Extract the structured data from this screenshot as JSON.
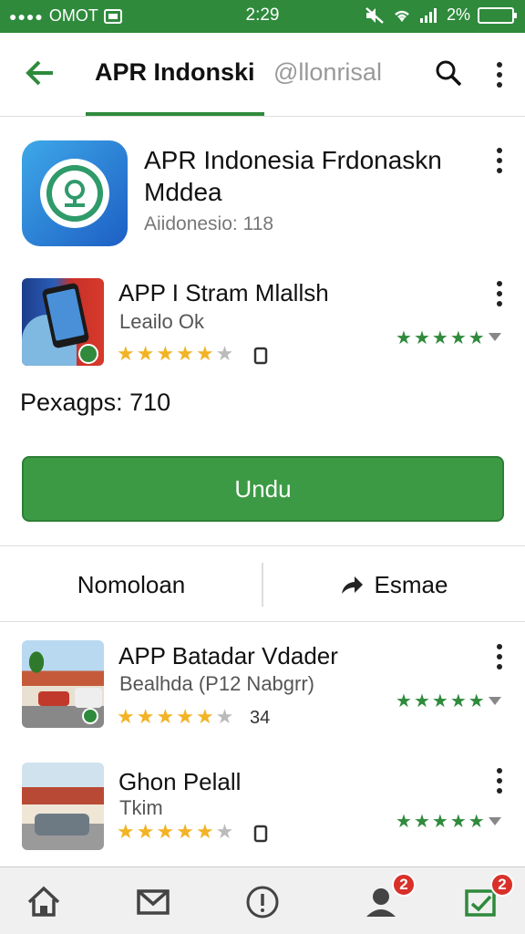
{
  "status_bar": {
    "carrier": "OMOT",
    "time": "2:29",
    "battery": "2%",
    "bg_color": "#2f8a3c"
  },
  "app_bar": {
    "title": "APR Indonski",
    "subtitle": "@llonrisal",
    "back_icon": "arrow-left-icon",
    "search_icon": "search-icon",
    "more_icon": "more-vert-icon"
  },
  "hero": {
    "title": "APR Indonesia Frdonaskn Mddea",
    "meta": "Aiidonesio:  118"
  },
  "featured_app": {
    "title": "APP I Stram Mlallsh",
    "subtitle": "Leailo Ok",
    "rating": 4
  },
  "packages_label": "Pexagps:  710",
  "install_button": {
    "label": "Undu",
    "color": "#3c9a45"
  },
  "actions": {
    "left_label": "Nomoloan",
    "right_label": "Esmae"
  },
  "list": [
    {
      "title": "APP Batadar Vdader",
      "subtitle": "Bealhda (P12 Nabgrr)",
      "rating": 4,
      "count": "34"
    },
    {
      "title": "Ghon Pelall",
      "subtitle": "Tkim",
      "rating": 4
    }
  ],
  "bottom_nav": {
    "items": [
      "home-icon",
      "mail-icon",
      "info-icon",
      "account-icon",
      "updates-icon"
    ],
    "badges": [
      "2",
      "2"
    ]
  },
  "colors": {
    "accent": "#2f8a3c",
    "star": "#f2b325",
    "badge": "#d9302a"
  }
}
